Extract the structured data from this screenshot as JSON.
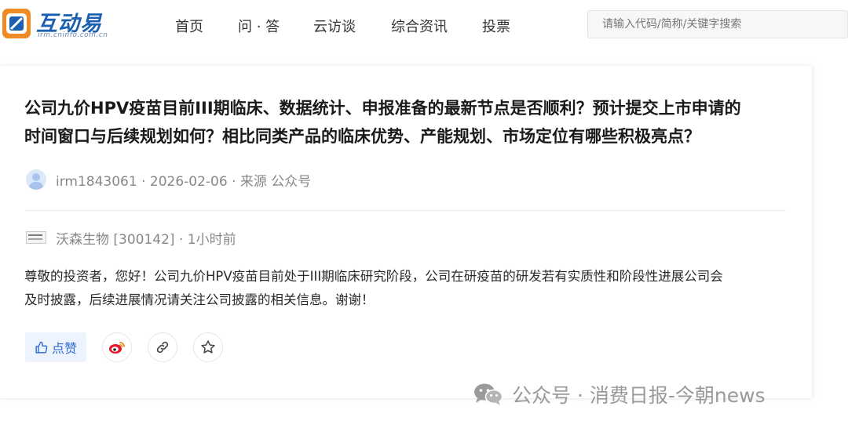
{
  "header": {
    "logo_title": "互动易",
    "logo_url": "irm.cninfo.com.cn",
    "nav": [
      "首页",
      "问 · 答",
      "云访谈",
      "综合资讯",
      "投票"
    ],
    "search_placeholder": "请输入代码/简称/关键字搜索"
  },
  "question": {
    "title_line1": "公司九价HPV疫苗目前III期临床、数据统计、申报准备的最新节点是否顺利？预计提交上市申请的",
    "title_line2": "时间窗口与后续规划如何？相比同类产品的临床优势、产能规划、市场定位有哪些积极亮点？",
    "meta": "irm1843061 · 2026-02-06 · 来源 公众号"
  },
  "answer": {
    "company": "沃森生物 [300142] · 1小时前",
    "text_line1": "尊敬的投资者，您好！公司九价HPV疫苗目前处于III期临床研究阶段，公司在研疫苗的研发若有实质性和阶段性进展公司会",
    "text_line2": "及时披露，后续进展情况请关注公司披露的相关信息。谢谢！"
  },
  "actions": {
    "like_label": "点赞",
    "icons": [
      "thumbs-up-icon",
      "weibo-icon",
      "link-icon",
      "star-icon"
    ]
  },
  "watermark": "公众号 · 消费日报-今朝news",
  "colors": {
    "accent": "#2f6cd0",
    "brand": "#1b5fb0",
    "logo_orange": "#f08a24",
    "weibo_red": "#e6162d",
    "meta_gray": "#888888"
  }
}
